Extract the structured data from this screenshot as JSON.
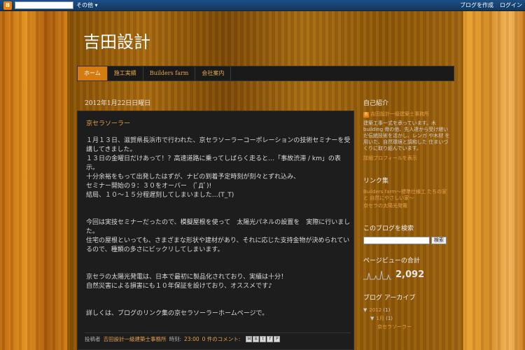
{
  "navbar": {
    "logo": "B",
    "more_label": "その他 ▾",
    "create_blog": "ブログを作成",
    "login": "ログイン"
  },
  "blog": {
    "title": "吉田設計",
    "tabs": [
      {
        "label": "ホーム",
        "active": true
      },
      {
        "label": "施工実績",
        "active": false
      },
      {
        "label": "Builders farm",
        "active": false
      },
      {
        "label": "会社案内",
        "active": false
      }
    ]
  },
  "post": {
    "date": "2012年1月22日日曜日",
    "title": "京セラソーラー",
    "paragraphs": [
      "１月１３日、滋賀県長浜市で行われた、京セラソーラーコーポレーションの技術セミナーを受講してきました。",
      "１３日の金曜日だけあって！？高速道路に乗ってしばらく走ると…「事故渋滞 / km」の表示。",
      "十分余裕をもって出発したはずが、ナビの到着予定時刻が刻々とずれ込み、",
      "セミナー開始の９：３０をオーバー　(ﾟДﾟ)!",
      "結局、１０～１５分程遅刻してしまいました…(T_T)",
      "今回は実技セミナーだったので、模擬屋根を使って　太陽光パネルの設置を　実際に行いました。",
      "住宅の屋根といっても、さまざまな形状や建材があり、それに応じた支持金物が決められているので、種類の多さにビックリしてしまいます。",
      "京セラの太陽光発電は、日本で最初に製品化されており、実績は十分！",
      "自然災害による損害にも１０年保証を設けており、オススメです♪",
      "詳しくは、ブログのリンク集の京セラソーラーホームページで。"
    ],
    "footer": {
      "posted_by": "投稿者",
      "author": "吉田設計一級建築士事務所",
      "time_prefix": "時刻:",
      "time": "23:00",
      "comments": "0 件のコメント:",
      "share_icons": [
        "M",
        "B",
        "t",
        "f",
        "P"
      ]
    }
  },
  "sidebar": {
    "profile": {
      "title": "自己紹介",
      "name": "吉田設計一級建築士事務所",
      "description": "建築工事一式を承っています。木building 骨の他、先人達から受け継いだ伝統技術を活かし、レンガ や木材 を用いた、自然環境と調和した 住まいづくりに取り組んでいます。",
      "profile_link": "詳細プロフィールを表示"
    },
    "links": {
      "title": "リンク集",
      "items": [
        "Builders farm～標準仕様工 たちの家と 自然にやさしい家～",
        "京セラの太陽光発電"
      ]
    },
    "search": {
      "title": "このブログを検索",
      "button": "検索"
    },
    "pageviews": {
      "title": "ページビューの合計",
      "count": "2,092"
    },
    "archive": {
      "title": "ブログ アーカイブ",
      "year": "2012",
      "year_count": "(1)",
      "month": "1月",
      "month_count": "(1)",
      "post": "京セラソーラー"
    }
  }
}
